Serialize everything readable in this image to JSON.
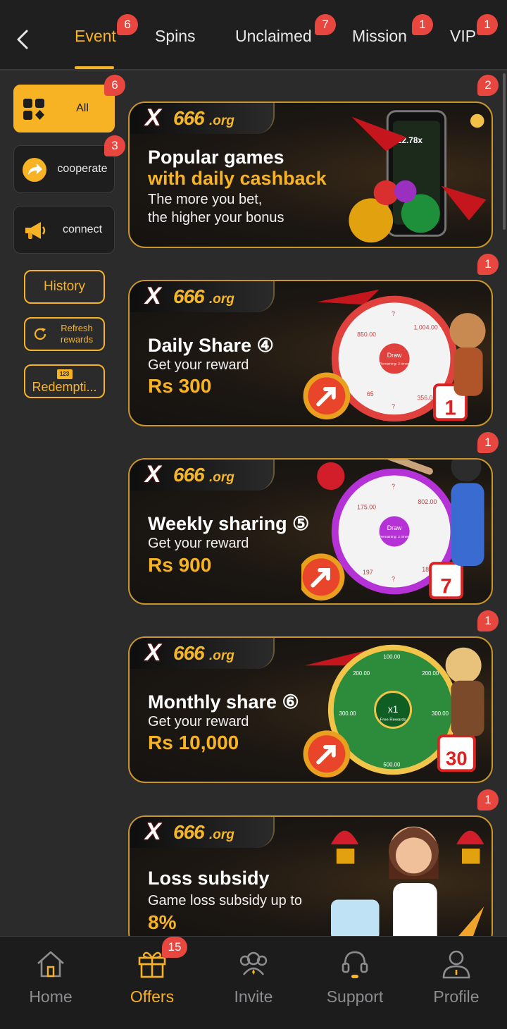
{
  "header": {
    "tabs": [
      {
        "label": "Event",
        "badge": "6",
        "active": true
      },
      {
        "label": "Spins",
        "badge": ""
      },
      {
        "label": "Unclaimed",
        "badge": "7"
      },
      {
        "label": "Mission",
        "badge": "1"
      },
      {
        "label": "VIP",
        "badge": "1"
      }
    ]
  },
  "sidebar": {
    "items": [
      {
        "label": "All",
        "badge": "6",
        "icon": "grid-cards-icon"
      },
      {
        "label": "cooperate",
        "badge": "3",
        "icon": "share-arrow-icon"
      },
      {
        "label": "connect",
        "badge": "",
        "icon": "megaphone-icon"
      }
    ],
    "history": "History",
    "refresh": "Refresh rewards",
    "redemption": "Redempti...",
    "redemption_icon_text": "123"
  },
  "cards": [
    {
      "title": "Popular games",
      "title2": "with daily cashback",
      "sub": "The more you bet,",
      "sub2": "the higher your bonus",
      "badge": "2",
      "art_text": "12.78x"
    },
    {
      "title": "Daily Share ④",
      "sub": "Get your reward",
      "amount": "Rs 300",
      "badge": "1",
      "day": "1",
      "wheel": [
        "850.00",
        "1,004.00",
        "356.00",
        "65",
        "?",
        "?"
      ]
    },
    {
      "title": "Weekly sharing ⑤",
      "sub": "Get your reward",
      "amount": "Rs 900",
      "badge": "1",
      "day": "7",
      "wheel": [
        "175.00",
        "802.00",
        "180.00",
        "197",
        "?",
        "?"
      ]
    },
    {
      "title": "Monthly share ⑥",
      "sub": "Get your reward",
      "amount": "Rs 10,000",
      "badge": "1",
      "day": "30",
      "wheel": [
        "100.00",
        "200.00",
        "200.00",
        "300.00",
        "300.00",
        "500.00"
      ],
      "wheel_center": "x1",
      "wheel_center_sub": "Free Rewards"
    },
    {
      "title": "Loss subsidy",
      "sub": "Game loss subsidy up to",
      "amount": "8%",
      "badge": "1"
    }
  ],
  "wheel_draw": "Draw",
  "wheel_remaining_1": "Remaining: 2 times",
  "wheel_remaining_2": "Remaining: 2 times",
  "logo": {
    "x": "X",
    "num": "666",
    "org": ".org"
  },
  "bottom_nav": {
    "items": [
      {
        "label": "Home",
        "icon": "home-icon"
      },
      {
        "label": "Offers",
        "icon": "gift-icon",
        "badge": "15",
        "active": true
      },
      {
        "label": "Invite",
        "icon": "invite-icon"
      },
      {
        "label": "Support",
        "icon": "headset-icon"
      },
      {
        "label": "Profile",
        "icon": "profile-icon"
      }
    ]
  },
  "colors": {
    "accent": "#f7b324",
    "badge": "#e8473f",
    "bg": "#2b2b2c"
  }
}
